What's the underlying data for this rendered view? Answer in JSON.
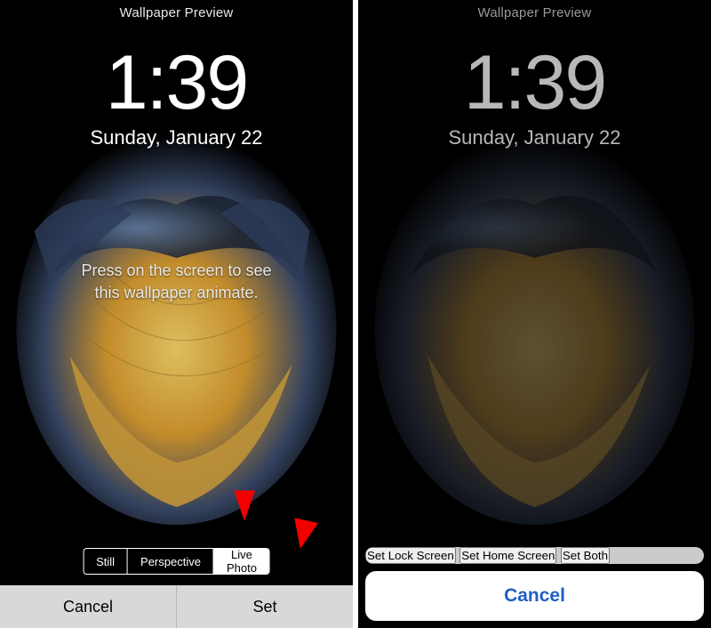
{
  "left": {
    "header": "Wallpaper Preview",
    "time": "1:39",
    "date": "Sunday, January 22",
    "hint_line1": "Press on the screen to see",
    "hint_line2": "this wallpaper animate.",
    "segments": {
      "still": "Still",
      "perspective": "Perspective",
      "live": "Live Photo"
    },
    "bottom": {
      "cancel": "Cancel",
      "set": "Set"
    }
  },
  "right": {
    "header": "Wallpaper Preview",
    "time": "1:39",
    "date": "Sunday, January 22",
    "sheet": {
      "lock": "Set Lock Screen",
      "home": "Set Home Screen",
      "both": "Set Both",
      "cancel": "Cancel"
    }
  }
}
